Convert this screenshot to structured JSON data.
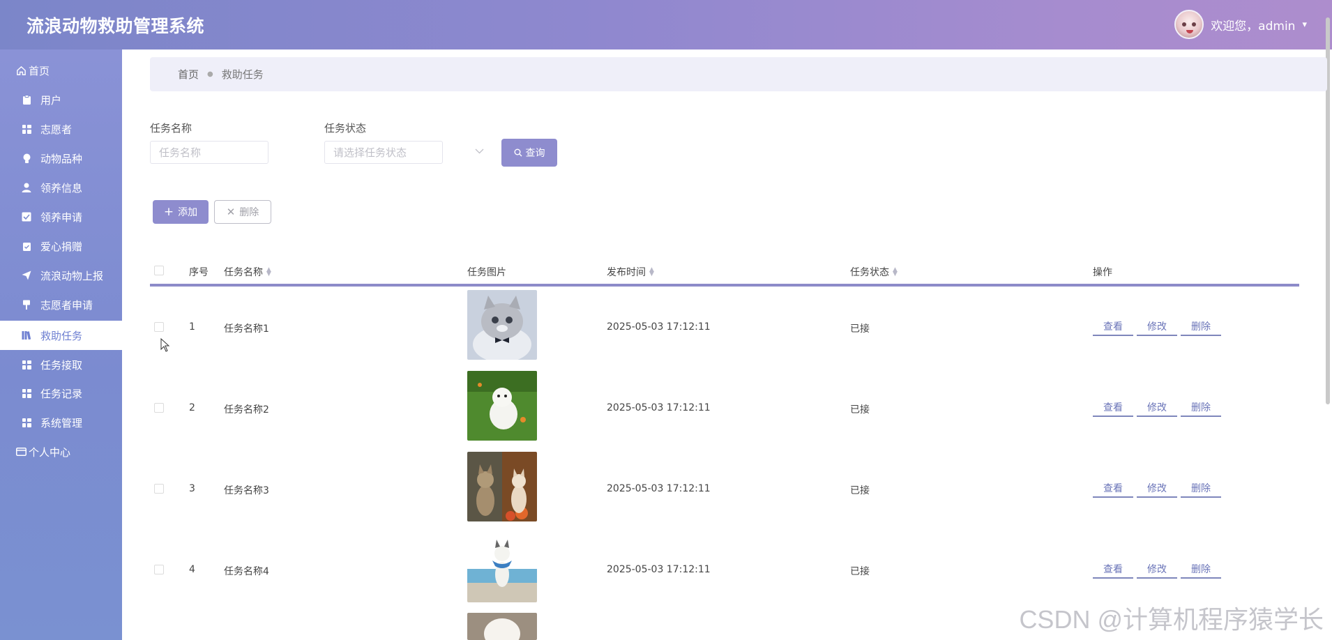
{
  "header": {
    "title": "流浪动物救助管理系统",
    "welcome": "欢迎您，admin",
    "caret": "▾"
  },
  "sidebar": {
    "items": [
      {
        "label": "首页",
        "icon": "home-icon"
      },
      {
        "label": "用户",
        "icon": "clipboard-icon"
      },
      {
        "label": "志愿者",
        "icon": "grid-icon"
      },
      {
        "label": "动物品种",
        "icon": "bulb-icon"
      },
      {
        "label": "领养信息",
        "icon": "user-icon"
      },
      {
        "label": "领养申请",
        "icon": "check-square-icon"
      },
      {
        "label": "爱心捐赠",
        "icon": "clipboard-check-icon"
      },
      {
        "label": "流浪动物上报",
        "icon": "send-icon"
      },
      {
        "label": "志愿者申请",
        "icon": "pin-icon"
      },
      {
        "label": "救助任务",
        "icon": "book-icon"
      },
      {
        "label": "任务接取",
        "icon": "grid-icon"
      },
      {
        "label": "任务记录",
        "icon": "grid-icon"
      },
      {
        "label": "系统管理",
        "icon": "grid-icon"
      },
      {
        "label": "个人中心",
        "icon": "wallet-icon"
      }
    ]
  },
  "breadcrumb": {
    "home": "首页",
    "current": "救助任务"
  },
  "search": {
    "name_label": "任务名称",
    "name_placeholder": "任务名称",
    "status_label": "任务状态",
    "status_placeholder": "请选择任务状态",
    "query_button": "查询"
  },
  "toolbar": {
    "add_button": "添加",
    "delete_button": "删除"
  },
  "table": {
    "headers": {
      "index": "序号",
      "name": "任务名称",
      "image": "任务图片",
      "time": "发布时间",
      "status": "任务状态",
      "actions": "操作"
    },
    "rows": [
      {
        "index": "1",
        "name": "任务名称1",
        "time": "2025-05-03 17:12:11",
        "status": "已接",
        "image": "kitten-bowtie"
      },
      {
        "index": "2",
        "name": "任务名称2",
        "time": "2025-05-03 17:12:11",
        "status": "已接",
        "image": "white-puppy-grass"
      },
      {
        "index": "3",
        "name": "任务名称3",
        "time": "2025-05-03 17:12:11",
        "status": "已接",
        "image": "two-kittens-autumn"
      },
      {
        "index": "4",
        "name": "任务名称4",
        "time": "2025-05-03 17:12:11",
        "status": "已接",
        "image": "dog-scarf-sea"
      }
    ],
    "actions": {
      "view": "查看",
      "edit": "修改",
      "delete": "删除"
    }
  },
  "watermark": "CSDN @计算机程序猿学长",
  "colors": {
    "accent": "#8e8cce",
    "sidebar": "#7b8bd0",
    "active_text": "#6f80d2"
  }
}
